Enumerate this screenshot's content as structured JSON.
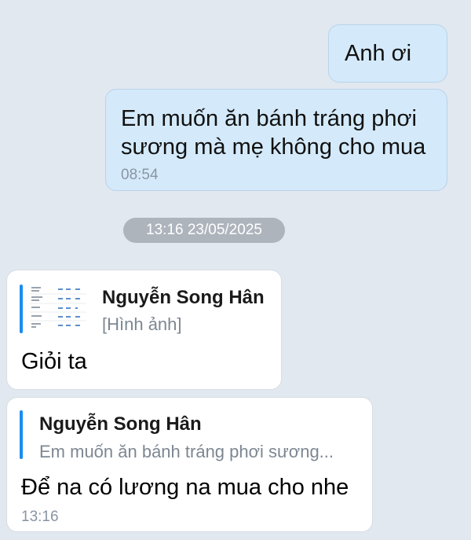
{
  "messages_out": [
    {
      "text": "Anh ơi"
    },
    {
      "text_line1": "Em muốn ăn bánh tráng phơi",
      "text_line2": "sương mà mẹ không cho mua",
      "time": "08:54"
    }
  ],
  "date_separator": "13:16 23/05/2025",
  "messages_in": [
    {
      "quote_name": "Nguyễn Song Hân",
      "quote_sub": "[Hình ảnh]",
      "text": "Giỏi ta"
    },
    {
      "quote_name": "Nguyễn Song Hân",
      "quote_sub": "Em muốn ăn bánh tráng phơi sương...",
      "text": "Để na có lương na mua cho nhe",
      "time": "13:16"
    }
  ],
  "colors": {
    "background": "#e2e8f0",
    "outgoing_bubble": "#d4eafb",
    "incoming_bubble": "#ffffff",
    "quote_accent": "#1a8cf0"
  }
}
